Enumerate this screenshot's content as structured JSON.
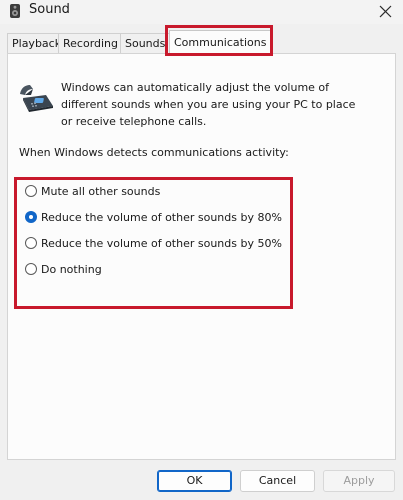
{
  "window": {
    "title": "Sound",
    "app_icon": "speaker-icon",
    "close_icon": "close-icon"
  },
  "tabs": [
    {
      "label": "Playback",
      "active": false
    },
    {
      "label": "Recording",
      "active": false
    },
    {
      "label": "Sounds",
      "active": false
    },
    {
      "label": "Communications",
      "active": true
    }
  ],
  "communications": {
    "icon": "telephone-icon",
    "description": "Windows can automatically adjust the volume of different sounds when you are using your PC to place or receive telephone calls.",
    "prompt": "When Windows detects communications activity:",
    "options": [
      {
        "label": "Mute all other sounds",
        "selected": false
      },
      {
        "label": "Reduce the volume of other sounds by 80%",
        "selected": true
      },
      {
        "label": "Reduce the volume of other sounds by 50%",
        "selected": false
      },
      {
        "label": "Do nothing",
        "selected": false
      }
    ]
  },
  "buttons": {
    "ok": "OK",
    "cancel": "Cancel",
    "apply": "Apply",
    "apply_enabled": false
  },
  "colors": {
    "highlight_outline": "#c8192c",
    "accent": "#1166c8"
  }
}
